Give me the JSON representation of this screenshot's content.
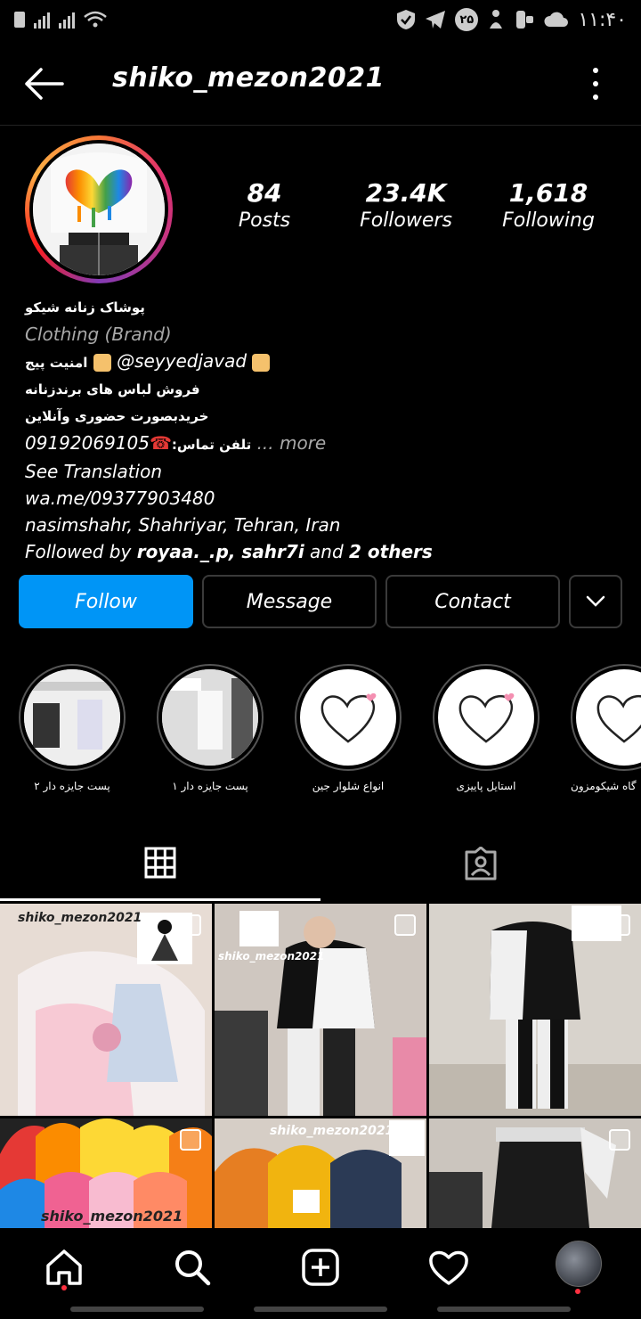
{
  "status_bar": {
    "time": "۱۱:۴۰",
    "badge": "۲۵"
  },
  "header": {
    "username": "shiko_mezon2021"
  },
  "stats": [
    {
      "value": "84",
      "label": "Posts"
    },
    {
      "value": "23.4K",
      "label": "Followers"
    },
    {
      "value": "1,618",
      "label": "Following"
    }
  ],
  "bio": {
    "name": "پوشاک زنانه شیکو",
    "category": "Clothing (Brand)",
    "line_security_label": "امنیت پیج",
    "line_security_handle": "@seyyedjavad",
    "line_sale": "فروش لباس های برندزنانه",
    "line_buy": "خریدبصورت حضوری وآنلاین",
    "phone": "09192069105",
    "phone_label": ":تلفن تماس",
    "more": "... more",
    "see_translation": "See Translation",
    "link": "wa.me/09377903480",
    "location": "nasimshahr, Shahriyar, Tehran, Iran",
    "followed_by_prefix": "Followed by",
    "followed_by_names": "royaa._.p, sahr7i",
    "followed_by_and": "and",
    "followed_by_others": "2 others"
  },
  "actions": {
    "follow": "Follow",
    "message": "Message",
    "contact": "Contact"
  },
  "highlights": [
    {
      "caption": "پست جایزه دار ۲"
    },
    {
      "caption": "پست جایزه دار ۱"
    },
    {
      "caption": "انواع شلوار جین"
    },
    {
      "caption": "استایل پاییزی"
    },
    {
      "caption": "گاه شیکومزون"
    }
  ],
  "grid_watermarks": [
    "shiko_mezon2021",
    "shiko_mezon2021",
    "shiko_mezon2021",
    "shiko_mezon2021"
  ],
  "colors": {
    "accent": "#0095f6",
    "background": "#000000",
    "notification": "#ff3040"
  }
}
